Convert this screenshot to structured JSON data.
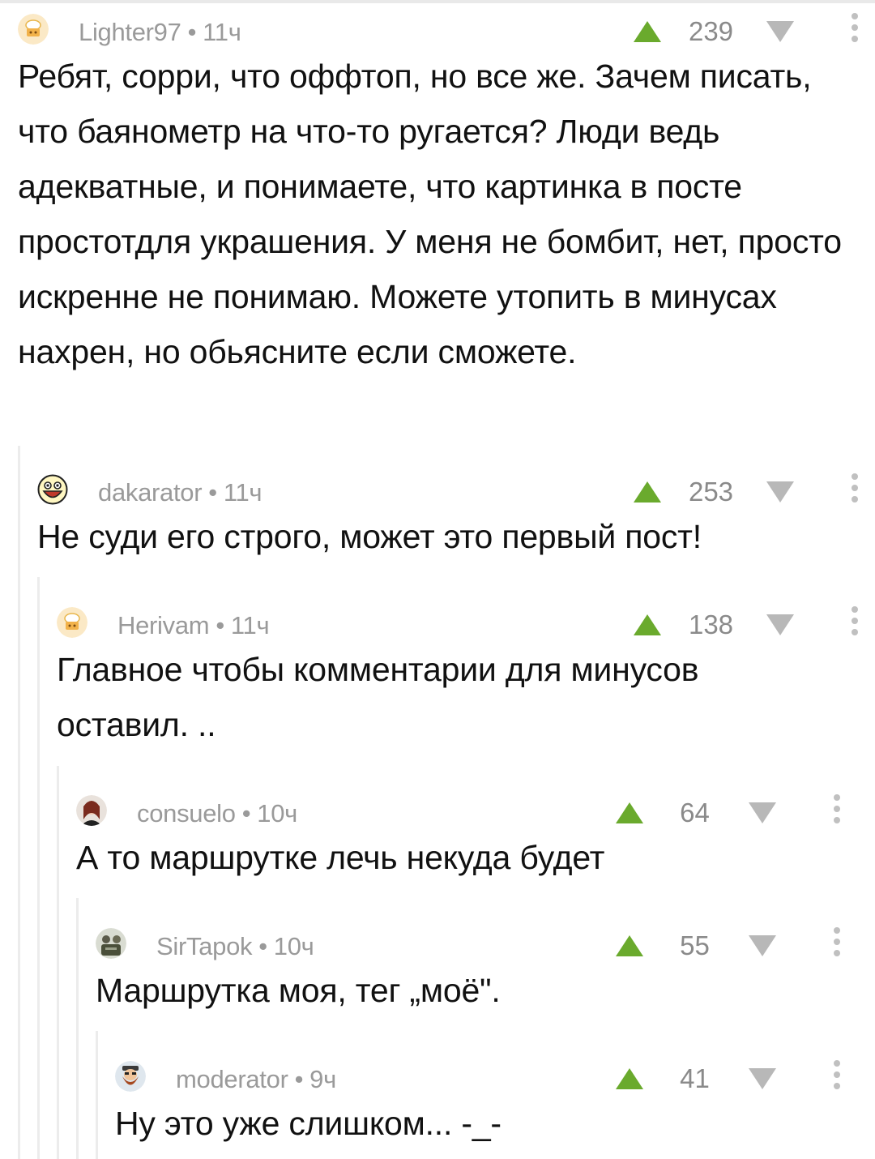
{
  "colors": {
    "upvote": "#6aaa2d",
    "downvote": "#b8b8b8",
    "meta": "#9a9a9a"
  },
  "comments": [
    {
      "author": "Lighter97",
      "time": "11ч",
      "rating": "239",
      "text": "Ребят, сорри, что оффтоп, но все же. Зачем писать, что баянометр на что-то ругается? Люди ведь адекватные, и понимаете, что картинка в посте простотдля украшения. У меня не бомбит, нет, просто искренне не понимаю. Можете утопить в минусах нахрен, но обьясните если сможете.",
      "avatar_icon": "chef-avatar-icon"
    },
    {
      "author": "dakarator",
      "time": "11ч",
      "rating": "253",
      "text": "Не суди его строго, может это первый пост!",
      "avatar_icon": "laughing-face-icon"
    },
    {
      "author": "Herivam",
      "time": "11ч",
      "rating": "138",
      "text": "Главное чтобы комментарии для минусов оставил. ..",
      "avatar_icon": "chef-avatar-icon"
    },
    {
      "author": "consuelo",
      "time": "10ч",
      "rating": "64",
      "text": "А то маршрутке лечь некуда будет",
      "avatar_icon": "photo-avatar-icon"
    },
    {
      "author": "SirTapok",
      "time": "10ч",
      "rating": "55",
      "text": "Маршрутка моя, тег „моё\".",
      "avatar_icon": "photo-avatar-icon"
    },
    {
      "author": "moderator",
      "time": "9ч",
      "rating": "41",
      "text": "Ну это уже слишком... -_-",
      "avatar_icon": "bearded-avatar-icon"
    }
  ]
}
